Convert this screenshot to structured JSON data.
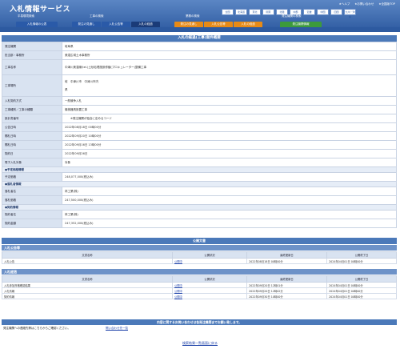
{
  "app": {
    "title": "入札情報サービス"
  },
  "top_links": [
    "★ヘルプ",
    "★お問い合わせ",
    "★全国版TOP"
  ],
  "regions": [
    "全国",
    "北海道",
    "東北",
    "関東",
    "北陸",
    "中部",
    "近畿",
    "中国",
    "四国",
    "九州・沖縄"
  ],
  "categories": [
    "平易環境検索",
    "工事の検索",
    "業務の検索",
    "発注機関の検索"
  ],
  "tabs": [
    "入札情報の公表",
    "発注の見通し",
    "入札公告等",
    "入札の経過",
    "発注の見通し",
    "入札公告等",
    "入札の経過",
    "発注機関情報"
  ],
  "colors": {
    "header": "#2d5aa0",
    "title_bar": "#4b79b9",
    "label_bg": "#d9e3f1",
    "tab_blue": "#2a5aa8",
    "tab_orange": "#e78a16",
    "tab_green": "#3c9a3c",
    "active_tab": "#1a3b78"
  },
  "main": {
    "title": "入札の経過(工事)案件概要",
    "rows": [
      {
        "label": "発注機関",
        "value": "岐阜県"
      },
      {
        "label": "担当部・事務所",
        "value": "美濃広域土木事務所"
      },
      {
        "label": "工事名称",
        "value": "中津川美濃線(tel.)土砂処理施設修繕(プロキュレーター)整備工事"
      },
      {
        "label": "工事場所",
        "value": "岐　中津川市　中津川市内\n県"
      },
      {
        "label": "入札契約方式",
        "value": "一般競争入札"
      },
      {
        "label": "工事種別／工事の種類",
        "value": "機械器具設置工事"
      },
      {
        "label": "設計書番号",
        "value": "　　※発注機関が独自に定めるコード"
      },
      {
        "label": "公告日時",
        "value": "2022年08月18日 00時00分"
      },
      {
        "label": "開札日時",
        "value": "2022年09月20日 10時00分"
      },
      {
        "label": "開札日時",
        "value": "2022年09月16日 13時00分"
      },
      {
        "label": "契約日",
        "value": "2022年09月26日"
      },
      {
        "label": "電子入札対象",
        "value": "対象"
      }
    ],
    "sections": [
      {
        "title": "●予定価格情報",
        "rows": [
          {
            "label": "予定価格",
            "value": "248,077,000(税込み)"
          }
        ]
      },
      {
        "title": "●落札者情報",
        "rows": [
          {
            "label": "落札者名",
            "value": "林工業(株)"
          },
          {
            "label": "落札価格",
            "value": "247,500,000(税込み)"
          }
        ]
      },
      {
        "title": "●契約情報",
        "rows": [
          {
            "label": "契約者名",
            "value": "林工業(株)"
          },
          {
            "label": "契約金額",
            "value": "247,352,000(税込み)"
          }
        ]
      }
    ]
  },
  "publication": {
    "title": "公開文書",
    "columns": [
      "文書名称",
      "公開状況",
      "最終更新日",
      "公開終了日"
    ],
    "groups": [
      {
        "name": "入札公告等",
        "rows": [
          {
            "name": "入札公告",
            "status": "公開中",
            "updated": "2022年08月18日 00時00分",
            "end": "2024年04月01日 00時00分"
          }
        ]
      },
      {
        "name": "入札経過",
        "rows": [
          {
            "name": "入札参加資格確認結果",
            "status": "公開中",
            "updated": "2022年09月20日 12時01分",
            "end": "2024年04月01日 00時00分"
          },
          {
            "name": "入札情報",
            "status": "公開中",
            "updated": "2022年09月20日 12時02分",
            "end": "2024年04月01日 00時00分"
          },
          {
            "name": "契約情報",
            "status": "公開中",
            "updated": "2022年09月30日 10時00分",
            "end": "2024年04月01日 00時00分"
          }
        ]
      }
    ]
  },
  "contact": {
    "title": "内容に関するお問い合わせは各発注機関までお願い致します。",
    "text": "発注機関への連絡先等はこちらからご確認ください。",
    "link": "問い合わせ先一覧"
  },
  "back_link": "検索結果一覧画面に戻る"
}
